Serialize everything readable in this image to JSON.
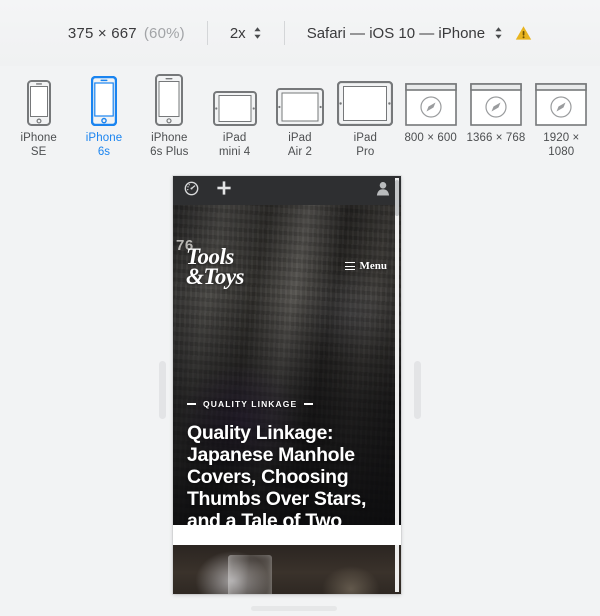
{
  "toolbar": {
    "dimensions": "375 × 667",
    "zoom_percent": "(60%)",
    "scale_value": "2x",
    "stepper_name": "scale-stepper",
    "user_agent": "Safari — iOS 10 — iPhone",
    "ua_stepper_name": "user-agent-stepper",
    "warning_icon": "warning-triangle-icon"
  },
  "devices": [
    {
      "label_line1": "iPhone",
      "label_line2": "SE",
      "kind": "phone",
      "selected": false,
      "name": "device-iphone-se"
    },
    {
      "label_line1": "iPhone",
      "label_line2": "6s",
      "kind": "phone",
      "selected": true,
      "name": "device-iphone-6s"
    },
    {
      "label_line1": "iPhone",
      "label_line2": "6s Plus",
      "kind": "phone",
      "selected": false,
      "name": "device-iphone-6s-plus"
    },
    {
      "label_line1": "iPad",
      "label_line2": "mini 4",
      "kind": "tablet-sm",
      "selected": false,
      "name": "device-ipad-mini-4"
    },
    {
      "label_line1": "iPad",
      "label_line2": "Air 2",
      "kind": "tablet-md",
      "selected": false,
      "name": "device-ipad-air-2"
    },
    {
      "label_line1": "iPad",
      "label_line2": "Pro",
      "kind": "tablet-lg",
      "selected": false,
      "name": "device-ipad-pro"
    },
    {
      "label_line1": "800 × 600",
      "label_line2": "",
      "kind": "desktop",
      "selected": false,
      "name": "device-desktop-800x600"
    },
    {
      "label_line1": "1366 × 768",
      "label_line2": "",
      "kind": "desktop",
      "selected": false,
      "name": "device-desktop-1366x768"
    },
    {
      "label_line1": "1920 × 1080",
      "label_line2": "",
      "kind": "desktop",
      "selected": false,
      "name": "device-desktop-1920x1080"
    }
  ],
  "preview": {
    "site_bar": {
      "dashboard_icon": "speedometer-icon",
      "add_icon": "plus-icon",
      "account_icon": "person-icon"
    },
    "background_number": "76",
    "logo_line1": "Tools",
    "logo_line2": "&Toys",
    "menu_label": "Menu",
    "menu_icon": "hamburger-icon",
    "kicker": "QUALITY LINKAGE",
    "headline": "Quality Linkage: Japanese Manhole Covers, Choosing Thumbs Over Stars, and a Tale of Two Products"
  },
  "colors": {
    "accent_blue": "#1a84f0",
    "device_gray": "#76787a",
    "warning_yellow": "#e8b41f",
    "background": "#f2f3f4",
    "site_bar": "#2e2f31"
  }
}
